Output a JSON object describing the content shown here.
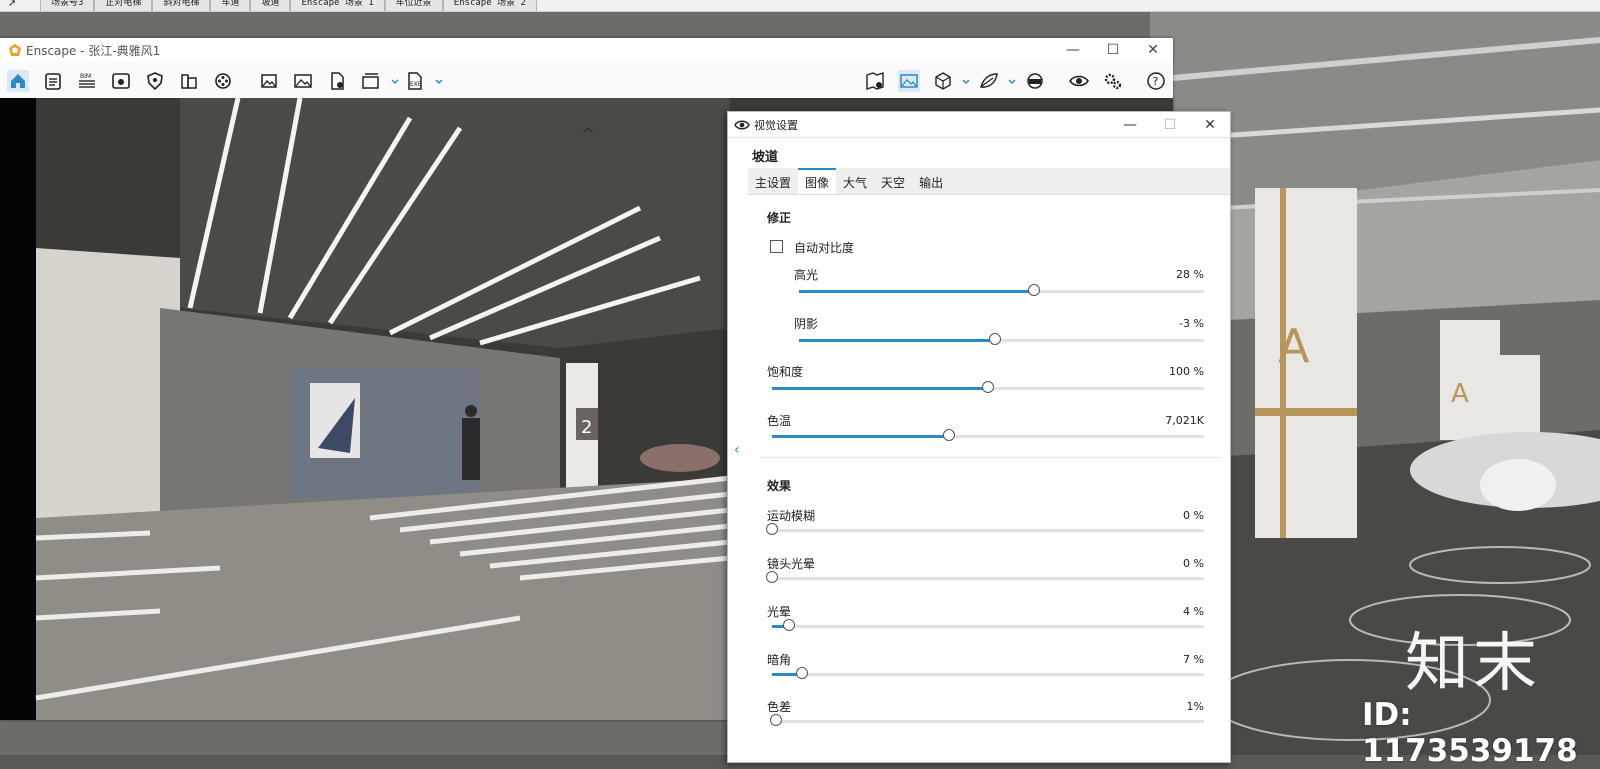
{
  "scene_tabs": [
    "场景号3",
    "正对电梯",
    "斜对电梯",
    "车道",
    "坡道",
    "Enscape 场景 1",
    "车位近景",
    "Enscape 场景 2"
  ],
  "enscape": {
    "title": "Enscape - 张江-典雅风1",
    "window_buttons": {
      "minimize": "—",
      "maximize": "☐",
      "close": "✕"
    },
    "toolbar_icons": [
      "home-icon",
      "asset-library-icon",
      "bim-icon",
      "live-view-icon",
      "shield-icon",
      "building-icon",
      "video-reel-icon",
      "screenshot-icon",
      "image-icon",
      "export-file-icon",
      "batch-render-icon",
      "exe-export-icon",
      "map-icon",
      "view-image-icon",
      "cube-icon",
      "leaf-icon",
      "vr-headset-icon",
      "eye-icon",
      "settings-icon",
      "help-icon"
    ],
    "bim_label": "BIM",
    "exe_label": "EXE",
    "help_label": "?"
  },
  "panel": {
    "title": "视觉设置",
    "preset": "坡道",
    "tabs": [
      "主设置",
      "图像",
      "大气",
      "天空",
      "输出"
    ],
    "active_tab": "图像",
    "correction_title": "修正",
    "auto_contrast_label": "自动对比度",
    "auto_contrast_checked": false,
    "correction_sliders": [
      {
        "label": "高光",
        "value": "28 %",
        "fraction": 0.58
      },
      {
        "label": "阴影",
        "value": "-3 %",
        "fraction": 0.485
      },
      {
        "label": "饱和度",
        "value": "100 %",
        "fraction": 0.5
      },
      {
        "label": "色温",
        "value": "7,021K",
        "fraction": 0.41
      }
    ],
    "effects_title": "效果",
    "effect_sliders": [
      {
        "label": "运动模糊",
        "value": "0 %",
        "fraction": 0.0
      },
      {
        "label": "镜头光晕",
        "value": "0 %",
        "fraction": 0.0
      },
      {
        "label": "光晕",
        "value": "4 %",
        "fraction": 0.04
      },
      {
        "label": "暗角",
        "value": "7 %",
        "fraction": 0.07
      },
      {
        "label": "色差",
        "value": "1%",
        "fraction": 0.01
      }
    ]
  },
  "watermark": {
    "logo": "知末",
    "id": "ID: 1173539178"
  },
  "colors": {
    "accent": "#2b8bc4",
    "panel_bg": "#ffffff",
    "tab_bar": "#eeeeee"
  }
}
